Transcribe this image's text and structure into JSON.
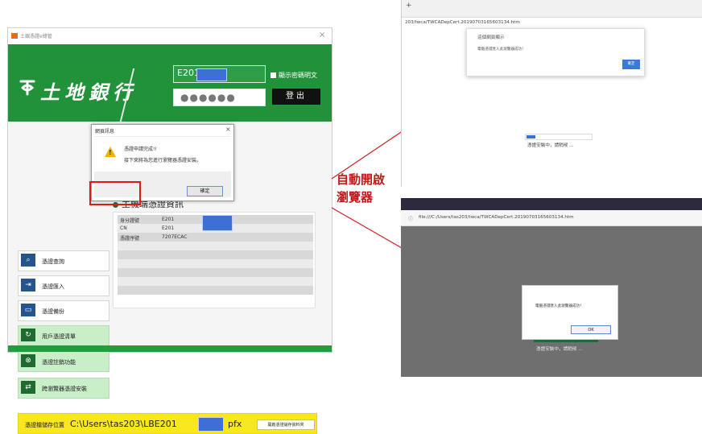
{
  "app": {
    "title": "土銀憑證e總管",
    "close_glyph": "×",
    "brand_name": "土地銀行",
    "id_prefix": "E201",
    "password_mask": "●●●●●●",
    "show_password_label": "顯示密碼明文",
    "logout_label": "登出",
    "cert_heading": "主機端憑證資訊",
    "cert_rows": [
      {
        "key": "身分證號",
        "value": "E201"
      },
      {
        "key": "CN",
        "value": "E201"
      },
      {
        "key": "憑證序號",
        "value": "7207ECAC"
      }
    ],
    "menu": [
      {
        "label": "憑證查詢",
        "icon": "certificate-search-icon",
        "glyph": "⌕"
      },
      {
        "label": "憑證匯入",
        "icon": "import-icon",
        "glyph": "⇥"
      },
      {
        "label": "憑證備份",
        "icon": "folder-icon",
        "glyph": "▭"
      },
      {
        "label": "用戶憑證清單",
        "icon": "refresh-icon",
        "glyph": "↻"
      },
      {
        "label": "憑證註銷功能",
        "icon": "revoke-icon",
        "glyph": "⊗"
      },
      {
        "label": "跨瀏覽器憑證安裝",
        "icon": "cross-browser-icon",
        "glyph": "⇄"
      }
    ],
    "dialog": {
      "title": "網頁訊息",
      "close_glyph": "×",
      "message_line1": "憑證申請完成!!",
      "message_line2": "接下來將為您進行瀏覽器憑證安裝。",
      "ok_label": "確定"
    },
    "path_bar": {
      "label": "憑證檔儲存位置",
      "value_prefix": "C:\\Users\\tas203\\LBE201",
      "value_suffix": "pfx",
      "open_folder_label": "開啟憑證儲存資料夾"
    }
  },
  "annotation": {
    "line1": "自動開啟",
    "line2": "瀏覽器",
    "color": "#c01a1a"
  },
  "browser_top": {
    "new_tab_glyph": "+",
    "url": "203/twca/TWCADepCert.20190703165603134.htm",
    "alert_title": "這個網頁顯示",
    "alert_message": "電腦憑證匯入此瀏覽器成功！",
    "alert_ok_label": "確定",
    "loading_text": "憑證安裝中，請稍候 ..."
  },
  "browser_bottom": {
    "info_glyph": "ⓘ",
    "url": "file:///C:/Users/tas203/twca/TWCADepCert.20190703165603134.htm",
    "alert_message": "電腦憑證匯入此瀏覽器成功！",
    "alert_ok_label": "OK",
    "loading_text": "憑證安裝中，請稍候 ..."
  },
  "colors": {
    "brand_green": "#22923a",
    "highlight_red": "#e01818",
    "path_bar_yellow": "#f8e71c",
    "mask_blue": "#3e6fd6"
  }
}
